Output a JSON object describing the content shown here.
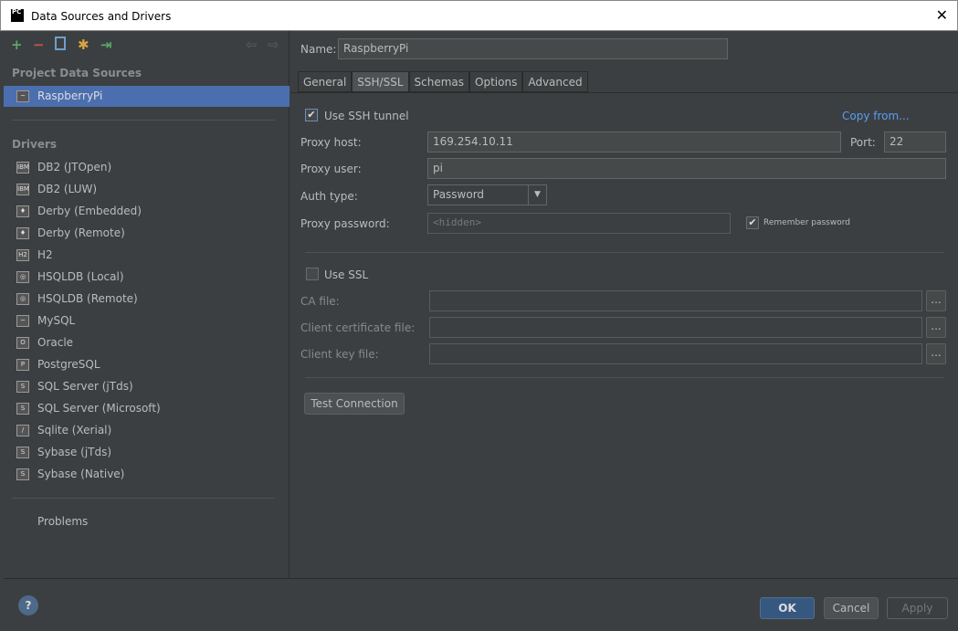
{
  "window": {
    "title": "Data Sources and Drivers",
    "logo": "PC",
    "close": "✕"
  },
  "toolbar": {
    "add": "+",
    "remove": "−",
    "copy": "copy-icon",
    "settings": "wrench-icon",
    "import": "import-icon",
    "back": "⇦",
    "forward": "⇨"
  },
  "sidebar": {
    "project_header": "Project Data Sources",
    "data_sources": [
      {
        "label": "RaspberryPi",
        "selected": true
      }
    ],
    "drivers_header": "Drivers",
    "drivers": [
      {
        "label": "DB2 (JTOpen)",
        "icon": "IBM"
      },
      {
        "label": "DB2 (LUW)",
        "icon": "IBM"
      },
      {
        "label": "Derby (Embedded)",
        "icon": "♦"
      },
      {
        "label": "Derby (Remote)",
        "icon": "♦"
      },
      {
        "label": "H2",
        "icon": "H2"
      },
      {
        "label": "HSQLDB (Local)",
        "icon": "◎"
      },
      {
        "label": "HSQLDB (Remote)",
        "icon": "◎"
      },
      {
        "label": "MySQL",
        "icon": "~"
      },
      {
        "label": "Oracle",
        "icon": "O"
      },
      {
        "label": "PostgreSQL",
        "icon": "P"
      },
      {
        "label": "SQL Server (jTds)",
        "icon": "S"
      },
      {
        "label": "SQL Server (Microsoft)",
        "icon": "S"
      },
      {
        "label": "Sqlite (Xerial)",
        "icon": "/"
      },
      {
        "label": "Sybase (jTds)",
        "icon": "S"
      },
      {
        "label": "Sybase (Native)",
        "icon": "S"
      }
    ],
    "problems": "Problems"
  },
  "form": {
    "name_label": "Name:",
    "name_value": "RaspberryPi",
    "tabs": [
      {
        "label": "General"
      },
      {
        "label": "SSH/SSL",
        "active": true
      },
      {
        "label": "Schemas"
      },
      {
        "label": "Options"
      },
      {
        "label": "Advanced"
      }
    ],
    "use_ssh": "Use SSH tunnel",
    "use_ssh_checked": true,
    "copy_from": "Copy from...",
    "proxy_host_label": "Proxy host:",
    "proxy_host": "169.254.10.11",
    "port_label": "Port:",
    "port": "22",
    "proxy_user_label": "Proxy user:",
    "proxy_user": "pi",
    "auth_type_label": "Auth type:",
    "auth_type": "Password",
    "proxy_password_label": "Proxy password:",
    "proxy_password_placeholder": "<hidden>",
    "remember_password": "Remember password",
    "remember_checked": true,
    "use_ssl": "Use SSL",
    "use_ssl_checked": false,
    "ca_file_label": "CA file:",
    "client_cert_label": "Client certificate file:",
    "client_key_label": "Client key file:",
    "browse": "...",
    "test_connection": "Test Connection"
  },
  "footer": {
    "help": "?",
    "ok": "OK",
    "cancel": "Cancel",
    "apply": "Apply"
  },
  "colors": {
    "accent": "#4b6eaf",
    "link": "#589df6",
    "background": "#3c3f41"
  }
}
